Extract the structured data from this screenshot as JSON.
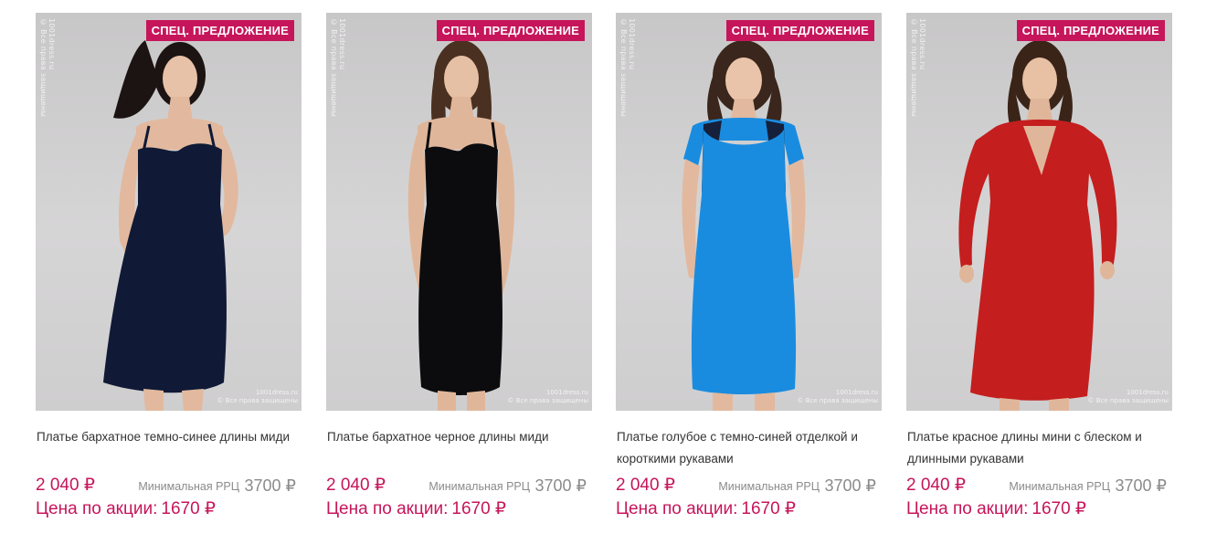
{
  "currency": "₽",
  "products": [
    {
      "badge": "СПЕЦ. ПРЕДЛОЖЕНИЕ",
      "title": "Платье бархатное темно-синее длины миди",
      "price": "2 040 ₽",
      "rrc_label": "Минимальная РРЦ",
      "rrc_value": "3700 ₽",
      "sale_label": "Цена по акции:",
      "sale_value": "1670 ₽",
      "dress_color": "#101a36",
      "watermark_side": "1001dress.ru",
      "watermark_side2": "© Все права защищены",
      "watermark_corner": "1001dress.ru",
      "watermark_corner2": "© Все права защищены"
    },
    {
      "badge": "СПЕЦ. ПРЕДЛОЖЕНИЕ",
      "title": "Платье бархатное черное длины миди",
      "price": "2 040 ₽",
      "rrc_label": "Минимальная РРЦ",
      "rrc_value": "3700 ₽",
      "sale_label": "Цена по акции:",
      "sale_value": "1670 ₽",
      "dress_color": "#0c0c0e",
      "watermark_side": "1001dress.ru",
      "watermark_side2": "© Все права защищены",
      "watermark_corner": "1001dress.ru",
      "watermark_corner2": "© Все права защищены"
    },
    {
      "badge": "СПЕЦ. ПРЕДЛОЖЕНИЕ",
      "title": "Платье голубое с темно-синей отделкой и короткими рукавами",
      "price": "2 040 ₽",
      "rrc_label": "Минимальная РРЦ",
      "rrc_value": "3700 ₽",
      "sale_label": "Цена по акции:",
      "sale_value": "1670 ₽",
      "dress_color": "#1a8ce0",
      "watermark_side": "1001dress.ru",
      "watermark_side2": "© Все права защищены",
      "watermark_corner": "1001dress.ru",
      "watermark_corner2": "© Все права защищены"
    },
    {
      "badge": "СПЕЦ. ПРЕДЛОЖЕНИЕ",
      "title": "Платье красное длины мини с блеском и длинными рукавами",
      "price": "2 040 ₽",
      "rrc_label": "Минимальная РРЦ",
      "rrc_value": "3700 ₽",
      "sale_label": "Цена по акции:",
      "sale_value": "1670 ₽",
      "dress_color": "#c41e1e",
      "watermark_side": "1001dress.ru",
      "watermark_side2": "© Все права защищены",
      "watermark_corner": "1001dress.ru",
      "watermark_corner2": "© Все права защищены"
    }
  ]
}
